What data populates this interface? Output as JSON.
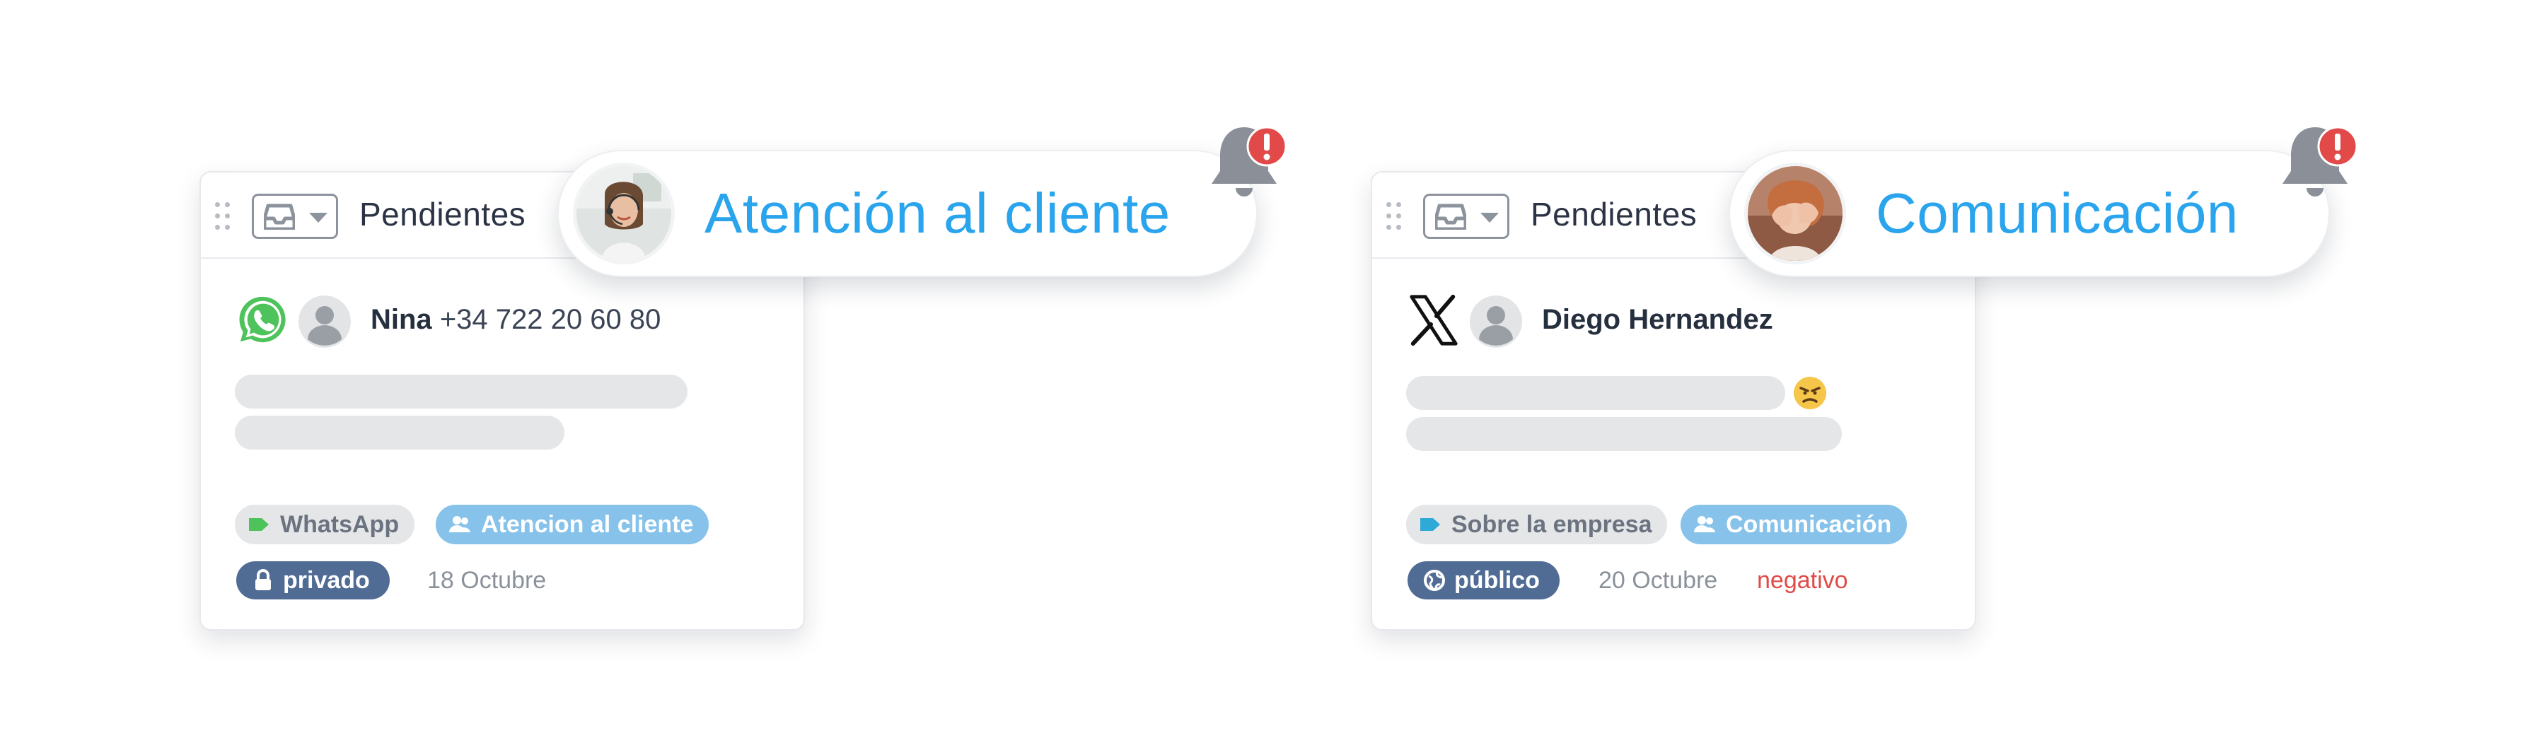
{
  "cards": [
    {
      "header": {
        "title": "Pendientes",
        "inbox_icon": "inbox-icon",
        "dropdown_icon": "caret-down-icon"
      },
      "notification": {
        "label": "Atención al cliente",
        "avatar": "support-agent-avatar",
        "bell_icon": "bell-icon",
        "alert_icon": "exclamation-alert-icon",
        "alert_color": "#e24a4a"
      },
      "conversation": {
        "channel_icon": "whatsapp-icon",
        "channel_color": "#4fc35b",
        "contact_name": "Nina",
        "contact_phone": "+34 722 20 60 80",
        "tags": [
          {
            "label": "WhatsApp",
            "icon": "tag-icon",
            "icon_color": "#4fc35b"
          },
          {
            "label": "Atencion al cliente",
            "icon": "users-icon",
            "style": "blue"
          }
        ],
        "visibility": {
          "label": "privado",
          "icon": "lock-icon"
        },
        "date": "18 Octubre"
      }
    },
    {
      "header": {
        "title": "Pendientes",
        "inbox_icon": "inbox-icon",
        "dropdown_icon": "caret-down-icon"
      },
      "notification": {
        "label": "Comunicación",
        "avatar": "stressed-person-avatar",
        "bell_icon": "bell-icon",
        "alert_icon": "exclamation-alert-icon",
        "alert_color": "#e24a4a"
      },
      "conversation": {
        "channel_icon": "x-logo-icon",
        "contact_name": "Diego Hernandez",
        "mood_icon": "angry-face-emoji",
        "tags": [
          {
            "label": "Sobre la empresa",
            "icon": "tag-icon",
            "icon_color": "#2fa9d6"
          },
          {
            "label": "Comunicación",
            "icon": "users-icon",
            "style": "blue"
          }
        ],
        "visibility": {
          "label": "público",
          "icon": "globe-icon"
        },
        "date": "20 Octubre",
        "sentiment": "negativo",
        "sentiment_color": "#e04b48"
      }
    }
  ],
  "colors": {
    "accent_blue": "#2aa4ec",
    "tag_blue": "#86c2ea",
    "badge_navy": "#506c95",
    "skeleton_grey": "#e5e6e8"
  }
}
